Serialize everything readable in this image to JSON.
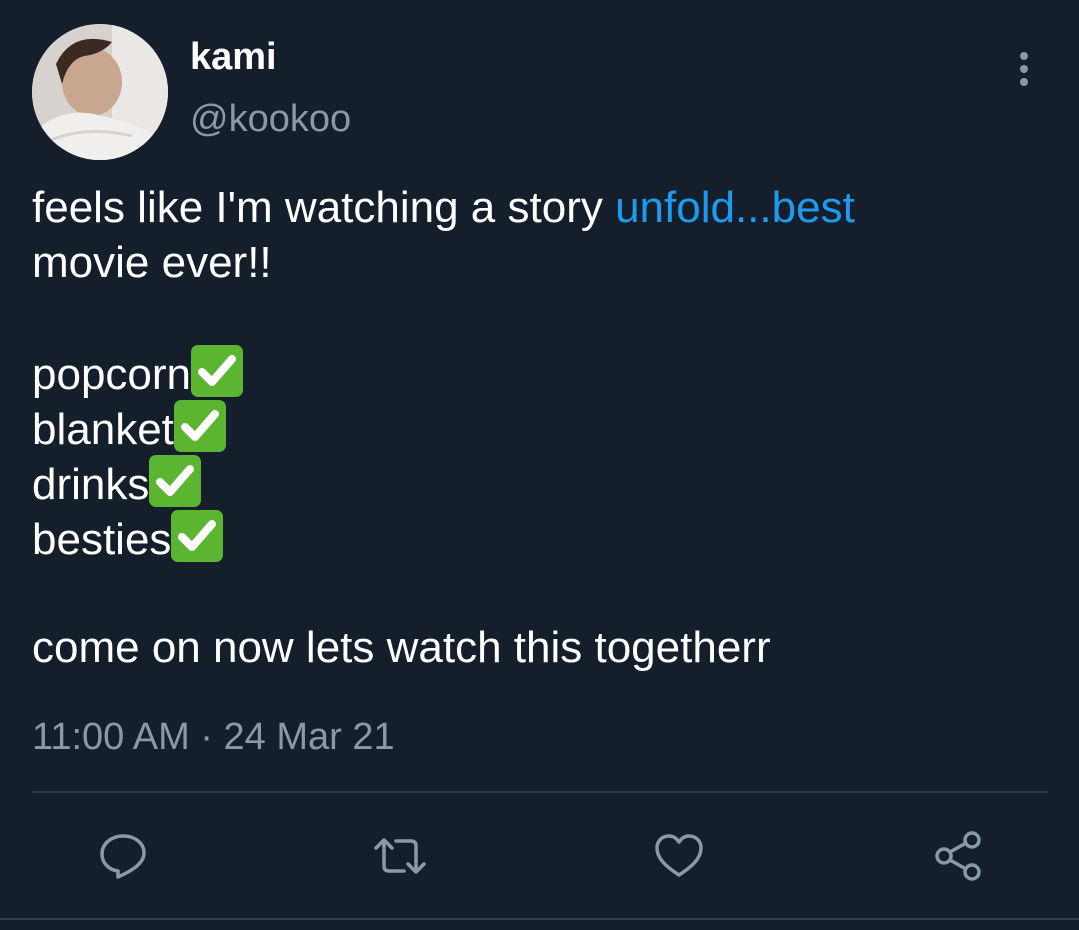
{
  "author": {
    "display_name": "kami",
    "handle": "@kookoo"
  },
  "tweet": {
    "line1_text": "feels like I'm watching a story ",
    "line1_link": "unfold...best",
    "line2": "movie ever!!",
    "list": [
      {
        "label": "popcorn",
        "icon": "check-mark-button-emoji"
      },
      {
        "label": "blanket",
        "icon": "check-mark-button-emoji"
      },
      {
        "label": "drinks",
        "icon": "check-mark-button-emoji"
      },
      {
        "label": "besties",
        "icon": "check-mark-button-emoji"
      }
    ],
    "closing": "come on now lets watch this togetherr",
    "timestamp": "11:00 AM · 24 Mar 21"
  },
  "actions": [
    {
      "name": "reply",
      "icon": "reply-icon"
    },
    {
      "name": "retweet",
      "icon": "retweet-icon"
    },
    {
      "name": "like",
      "icon": "heart-icon"
    },
    {
      "name": "share",
      "icon": "share-icon"
    }
  ],
  "colors": {
    "background": "#151f2b",
    "text": "#ffffff",
    "secondary_text": "#8b98a5",
    "link": "#1d9bf0",
    "check_green": "#5cb531"
  }
}
